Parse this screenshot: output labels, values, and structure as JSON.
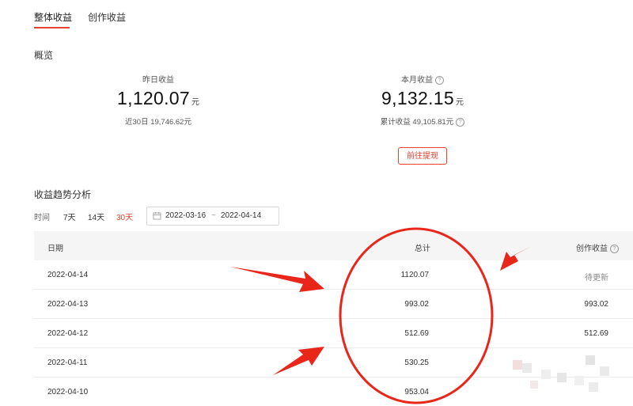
{
  "tabs": [
    {
      "label": "整体收益",
      "active": true
    },
    {
      "label": "创作收益",
      "active": false
    }
  ],
  "overview": {
    "title": "概览",
    "yesterday": {
      "label": "昨日收益",
      "value": "1,120.07",
      "unit": "元",
      "sub": "近30日 19,746.62元"
    },
    "month": {
      "label": "本月收益",
      "value": "9,132.15",
      "unit": "元",
      "sub": "累计收益 49,105.81元"
    },
    "withdraw_label": "前往提现"
  },
  "trend": {
    "title": "收益趋势分析",
    "time_label": "时间",
    "ranges": [
      {
        "label": "7天",
        "active": false
      },
      {
        "label": "14天",
        "active": false
      },
      {
        "label": "30天",
        "active": true
      }
    ],
    "date_start": "2022-03-16",
    "date_sep": "~",
    "date_end": "2022-04-14"
  },
  "table": {
    "headers": {
      "date": "日期",
      "total": "总计",
      "creation": "创作收益"
    },
    "rows": [
      {
        "date": "2022-04-14",
        "total": "1120.07",
        "creation": "待更新"
      },
      {
        "date": "2022-04-13",
        "total": "993.02",
        "creation": "993.02"
      },
      {
        "date": "2022-04-12",
        "total": "512.69",
        "creation": "512.69"
      },
      {
        "date": "2022-04-11",
        "total": "530.25",
        "creation": ""
      },
      {
        "date": "2022-04-10",
        "total": "953.04",
        "creation": ""
      }
    ]
  },
  "colors": {
    "accent": "#e8412e",
    "annotation": "#e8261a"
  }
}
